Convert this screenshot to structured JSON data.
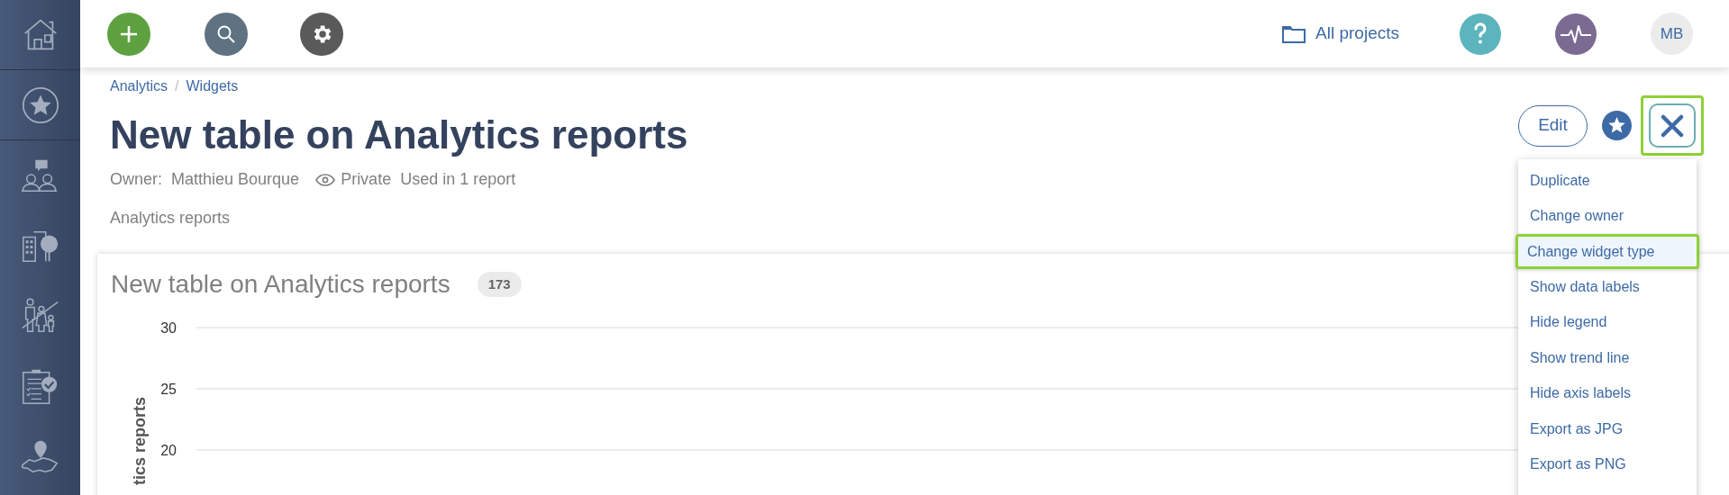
{
  "sidebar": {
    "items": [
      {
        "kind": "home"
      },
      {
        "kind": "star"
      },
      {
        "kind": "people"
      },
      {
        "kind": "buildings"
      },
      {
        "kind": "family"
      },
      {
        "kind": "checklist"
      },
      {
        "kind": "map"
      }
    ]
  },
  "topbar": {
    "projects": "All projects",
    "avatar": "MB"
  },
  "breadcrumb": [
    {
      "kind": "link",
      "text": "Analytics"
    },
    {
      "kind": "separator",
      "text": "/"
    },
    {
      "kind": "link",
      "text": "Widgets"
    }
  ],
  "title": "New table on Analytics reports",
  "meta": {
    "owner_label": "Owner:",
    "owner": "Matthieu Bourque",
    "visibility": "Private",
    "usage": "Used in 1 report"
  },
  "subtitle": "Analytics reports",
  "actions": {
    "edit": "Edit",
    "close_highlighted": true
  },
  "menu": [
    {
      "label": "Duplicate",
      "selected": false
    },
    {
      "label": "Change owner",
      "selected": false
    },
    {
      "label": "Change widget type",
      "selected": true
    },
    {
      "label": "Show data labels",
      "selected": false
    },
    {
      "label": "Hide legend",
      "selected": false
    },
    {
      "label": "Show trend line",
      "selected": false
    },
    {
      "label": "Hide axis labels",
      "selected": false
    },
    {
      "label": "Export as JPG",
      "selected": false
    },
    {
      "label": "Export as PNG",
      "selected": false
    }
  ],
  "card": {
    "title": "New table on Analytics reports",
    "count": "173",
    "y_axis": {
      "title": "tics reports",
      "ticks": [
        "30",
        "25",
        "20"
      ]
    }
  }
}
